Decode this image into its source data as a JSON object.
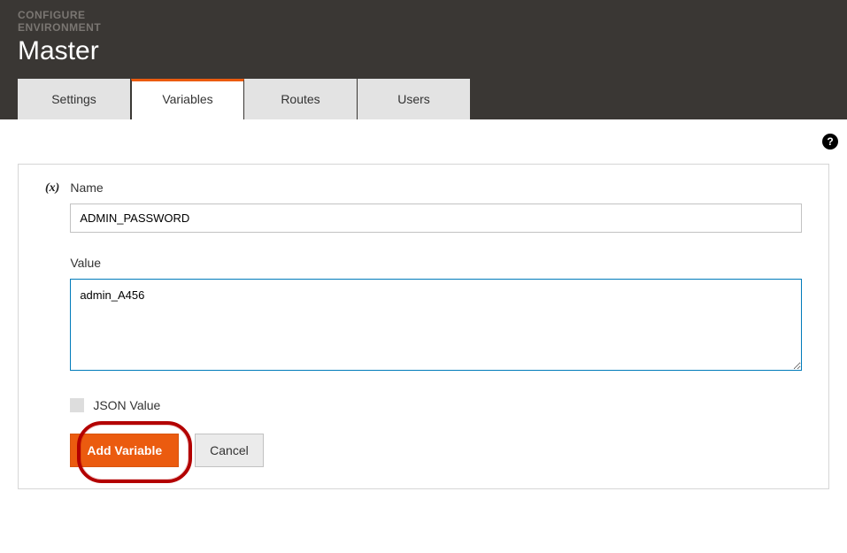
{
  "header": {
    "configure_line1": "CONFIGURE",
    "configure_line2": "ENVIRONMENT",
    "env_name": "Master"
  },
  "tabs": {
    "settings": "Settings",
    "variables": "Variables",
    "routes": "Routes",
    "users": "Users"
  },
  "help_icon_text": "?",
  "form": {
    "var_icon": "(x)",
    "name_label": "Name",
    "name_value": "ADMIN_PASSWORD",
    "value_label": "Value",
    "value_value": "admin_A456",
    "json_checkbox_label": "JSON Value",
    "add_button": "Add Variable",
    "cancel_button": "Cancel"
  }
}
